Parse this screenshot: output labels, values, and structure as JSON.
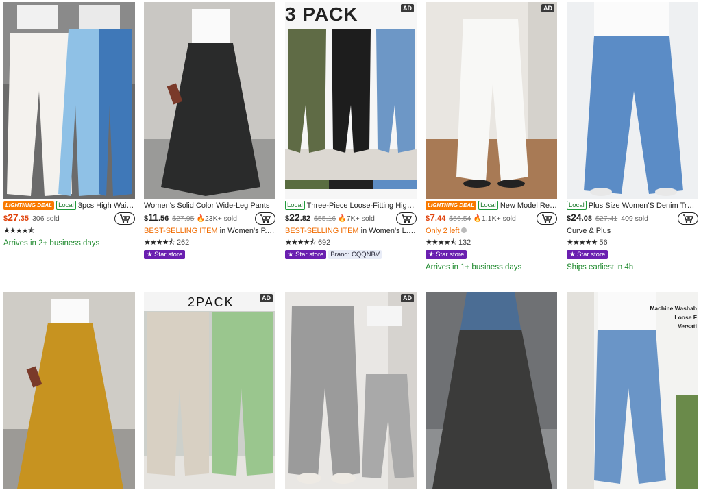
{
  "row1": [
    {
      "image_alt": "white and blue wide leg pants",
      "ad": "",
      "overlay": "",
      "lightning": "LIGHTNING DEAL",
      "local": "Local",
      "title": "3pcs High Waist ...",
      "currency": "$",
      "price_int": "27",
      "price_cents": ".35",
      "price_red": true,
      "orig_price": "",
      "flame": false,
      "sold": "306 sold",
      "sub": "",
      "sub2": "",
      "stars": "★★★★⯪",
      "rating_count": "",
      "star_store": false,
      "brand": "",
      "green": "Arrives in 2+ business days"
    },
    {
      "image_alt": "black wide leg pants",
      "ad": "",
      "overlay": "",
      "lightning": "",
      "local": "",
      "title": "Women's Solid Color Wide-Leg Pants",
      "currency": "$",
      "price_int": "11",
      "price_cents": ".56",
      "price_red": false,
      "orig_price": "$27.95",
      "flame": true,
      "sold": "23K+ sold",
      "sub": "BEST-SELLING ITEM",
      "sub2": " in Women's P...",
      "stars": "★★★★⯪",
      "rating_count": "262",
      "star_store": true,
      "brand": "",
      "green": ""
    },
    {
      "image_alt": "three pack harem pants",
      "ad": "AD",
      "overlay": "3 PACK",
      "lightning": "",
      "local": "Local",
      "title": "Three-Piece Loose-Fitting High-...",
      "currency": "$",
      "price_int": "22",
      "price_cents": ".82",
      "price_red": false,
      "orig_price": "$55.16",
      "flame": true,
      "sold": "7K+ sold",
      "sub": "BEST-SELLING ITEM",
      "sub2": " in Women's L...",
      "stars": "★★★★⯪",
      "rating_count": "692",
      "star_store": true,
      "brand": "Brand: CQQNBV",
      "green": ""
    },
    {
      "image_alt": "white relaxed pants",
      "ad": "AD",
      "overlay": "",
      "lightning": "LIGHTNING DEAL",
      "local": "Local",
      "title": "New Model Rela...",
      "currency": "$",
      "price_int": "7",
      "price_cents": ".44",
      "price_red": true,
      "orig_price": "$56.54",
      "flame": true,
      "sold": "1.1K+ sold",
      "sub": "Only 2 left",
      "sub2": "",
      "stars": "★★★★⯪",
      "rating_count": "132",
      "star_store": true,
      "brand": "",
      "green": "Arrives in 1+ business days"
    },
    {
      "image_alt": "blue denim wide leg jeans",
      "ad": "",
      "overlay": "",
      "lightning": "",
      "local": "Local",
      "title": "Plus Size Women'S Denim Trous...",
      "currency": "$",
      "price_int": "24",
      "price_cents": ".08",
      "price_red": false,
      "orig_price": "$27.41",
      "flame": false,
      "sold": "409 sold",
      "sub": "Curve & Plus",
      "sub2": "",
      "stars": "★★★★★",
      "rating_count": "56",
      "star_store": true,
      "brand": "",
      "green": "Ships earliest in 4h"
    }
  ],
  "row2": [
    {
      "ad": "",
      "overlay": ""
    },
    {
      "ad": "AD",
      "overlay": "2PACK"
    },
    {
      "ad": "AD",
      "overlay": ""
    },
    {
      "ad": "",
      "overlay": ""
    },
    {
      "ad": "",
      "overlay": "Machine Washab\nLoose F\nVersati"
    }
  ],
  "labels": {
    "star_store": "Star store"
  },
  "colors": {
    "accent_red": "#e0440e",
    "orange": "#f06b00",
    "star_store_bg": "#6a1fb0",
    "local_green": "#1f9a3a"
  }
}
